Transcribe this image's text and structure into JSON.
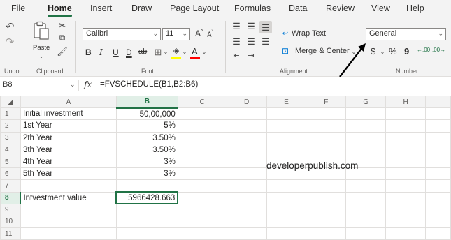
{
  "menu": {
    "tabs": [
      "File",
      "Home",
      "Insert",
      "Draw",
      "Page Layout",
      "Formulas",
      "Data",
      "Review",
      "View",
      "Help"
    ],
    "active": "Home"
  },
  "ribbon": {
    "groups": {
      "undo": "Undo",
      "clipboard": "Clipboard",
      "font": "Font",
      "alignment": "Alignment",
      "number": "Number"
    },
    "paste_label": "Paste",
    "font_name": "Calibri",
    "font_size": "11",
    "bold": "B",
    "italic": "I",
    "underline": "U",
    "double_underline": "D",
    "strikethrough": "ab",
    "font_color_letter": "A",
    "grow_font": "A",
    "shrink_font": "A",
    "wrap_text": "Wrap Text",
    "merge_center": "Merge & Center",
    "number_format": "General",
    "currency": "$",
    "percent": "%",
    "comma": "9",
    "inc_decimal": ".00",
    "dec_decimal": ".00",
    "colors": {
      "highlight": "#ffff00",
      "font_color": "#ff0000",
      "accent": "#217346"
    }
  },
  "formula_bar": {
    "name_box": "B8",
    "fx": "fx",
    "formula": "=FVSCHEDULE(B1,B2:B6)"
  },
  "grid": {
    "columns": [
      "A",
      "B",
      "C",
      "D",
      "E",
      "F",
      "G",
      "H",
      "I"
    ],
    "selected_column": "B",
    "selected_row": "8",
    "rows": [
      {
        "n": "1",
        "a": "Initial investment",
        "b": "50,00,000"
      },
      {
        "n": "2",
        "a": "1st Year",
        "b": "5%"
      },
      {
        "n": "3",
        "a": "2th Year",
        "b": "3.50%"
      },
      {
        "n": "4",
        "a": "3th Year",
        "b": "3.50%"
      },
      {
        "n": "5",
        "a": "4th Year",
        "b": "3%"
      },
      {
        "n": "6",
        "a": "5th Year",
        "b": "3%"
      },
      {
        "n": "7",
        "a": "",
        "b": ""
      },
      {
        "n": "8",
        "a": "Intvestment value",
        "b": "5966428.663"
      },
      {
        "n": "9",
        "a": "",
        "b": ""
      },
      {
        "n": "10",
        "a": "",
        "b": ""
      },
      {
        "n": "11",
        "a": "",
        "b": ""
      }
    ]
  },
  "watermark": "developerpublish.com"
}
